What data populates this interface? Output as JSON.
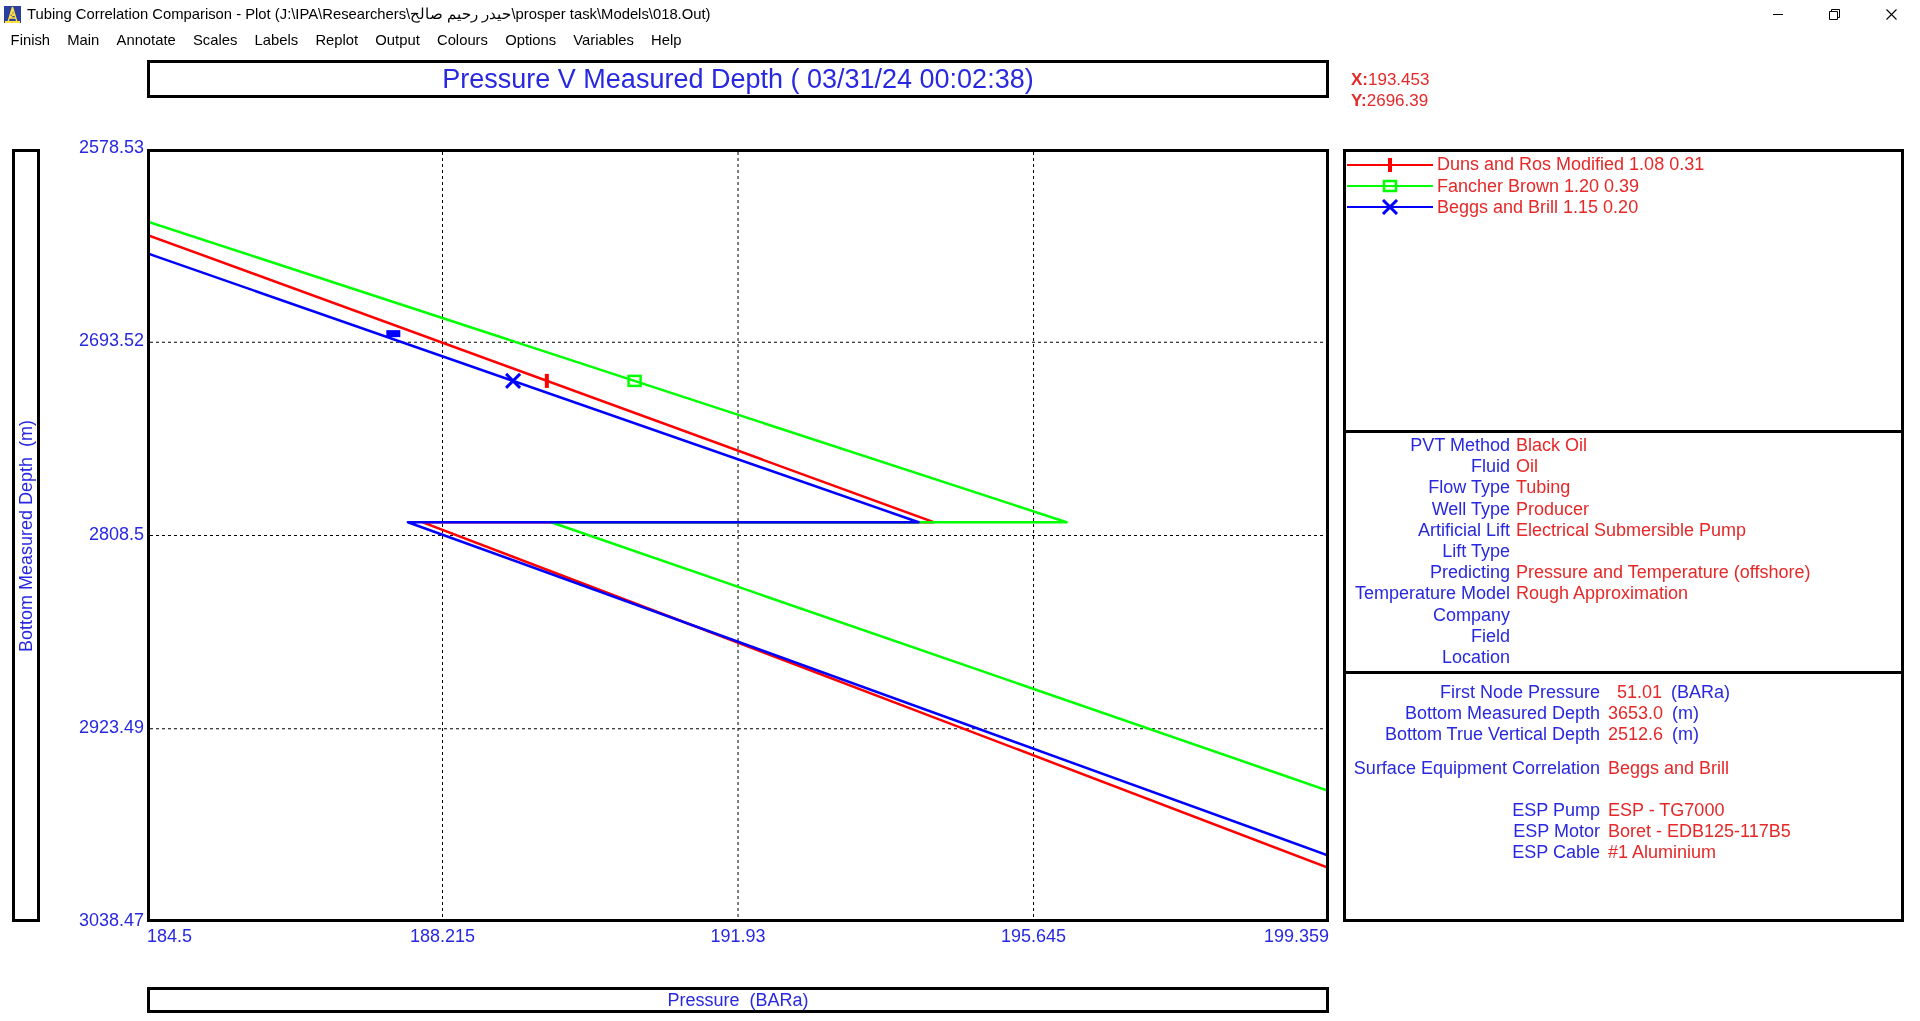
{
  "window": {
    "title": "Tubing Correlation Comparison - Plot (J:\\IPA\\Researchers\\حيدر رحيم صالح\\prosper task\\Models\\018.Out)"
  },
  "menu": [
    "Finish",
    "Main",
    "Annotate",
    "Scales",
    "Labels",
    "Replot",
    "Output",
    "Colours",
    "Options",
    "Variables",
    "Help"
  ],
  "plot": {
    "cursor_readout": [
      "**X:**193.453",
      "**Y:**2696.39"
    ],
    "chart_data": {
      "type": "line",
      "title": "Pressure V Measured Depth ( 03/31/24 00:02:38)",
      "xlabel": "Pressure  (BARa)",
      "ylabel": "Bottom Measured Depth  (m)",
      "xlim": [
        184.5,
        199.359
      ],
      "ylim": [
        3038.47,
        2578.53
      ],
      "xticks": [
        184.5,
        188.215,
        191.93,
        195.645,
        199.359
      ],
      "yticks": [
        2578.53,
        2693.52,
        2808.5,
        2923.49,
        3038.47
      ],
      "grid": true,
      "series": [
        {
          "name": "Duns and Ros Modified 1.08 0.31",
          "color": "#ff0000",
          "x": [
            184.5,
            194.39,
            187.96,
            199.359
          ],
          "values": [
            2629.6,
            2800.6,
            2800.6,
            3006.4
          ]
        },
        {
          "name": "Fancher Brown 1.20 0.39",
          "color": "#00ff00",
          "x": [
            184.5,
            196.06,
            189.58,
            199.359
          ],
          "values": [
            2621.6,
            2800.6,
            2800.6,
            2960.5
          ]
        },
        {
          "name": "Beggs and Brill 1.15 0.20",
          "color": "#0000ff",
          "x": [
            184.5,
            194.2,
            187.78,
            199.359
          ],
          "values": [
            2640.6,
            2800.6,
            2800.6,
            2999.1
          ]
        }
      ]
    }
  },
  "info_panel": [
    {
      "label": "PVT Method",
      "value": "Black Oil"
    },
    {
      "label": "Fluid",
      "value": "Oil"
    },
    {
      "label": "Flow Type",
      "value": "Tubing"
    },
    {
      "label": "Well Type",
      "value": "Producer"
    },
    {
      "label": "Artificial Lift",
      "value": "Electrical Submersible Pump"
    },
    {
      "label": "Lift Type"
    },
    {
      "label": "Predicting",
      "value": "Pressure and Temperature (offshore)"
    },
    {
      "label": "Temperature Model",
      "value": "Rough Approximation"
    },
    {
      "label": "Company"
    },
    {
      "label": "Field"
    },
    {
      "label": "Location"
    }
  ],
  "summary_panel": [
    {
      "rows": [
        {
          "label": "First Node Pressure",
          "value": "51.01",
          "unit": "(BARa)"
        },
        {
          "label": "Bottom Measured Depth",
          "value": "3653.0",
          "unit": "(m)"
        },
        {
          "label": "Bottom True Vertical Depth",
          "value": "2512.6",
          "unit": "(m)"
        }
      ]
    },
    {
      "rows": [
        {
          "label": "Surface Equipment Correlation",
          "value": "Beggs and Brill"
        }
      ]
    },
    {
      "rows": [
        {
          "label": "ESP Pump",
          "value": "ESP - TG7000"
        },
        {
          "label": "ESP Motor",
          "value": "Boret - EDB125-117B5"
        },
        {
          "label": "ESP Cable",
          "value": "#1 Aluminium"
        }
      ]
    }
  ]
}
